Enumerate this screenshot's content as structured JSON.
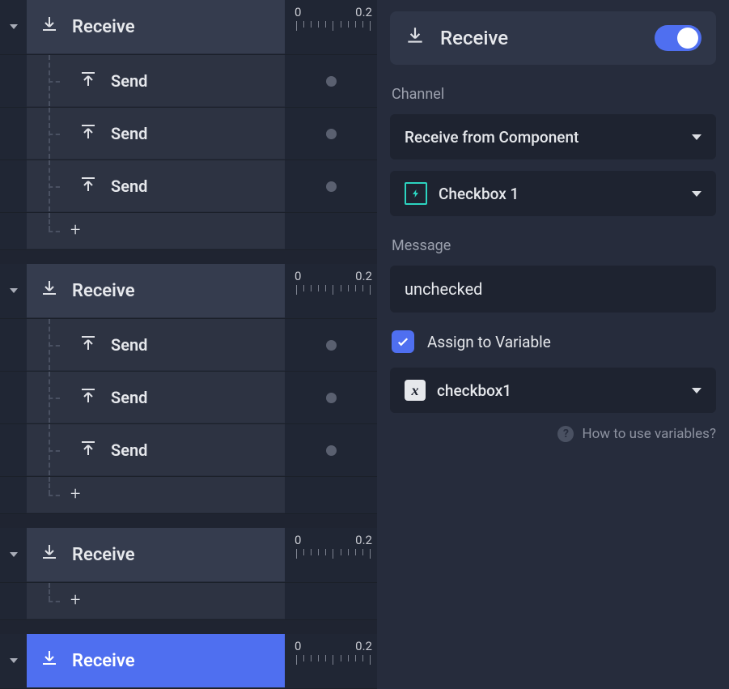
{
  "ruler": {
    "start": "0",
    "end": "0.2"
  },
  "labels": {
    "receive": "Receive",
    "send": "Send"
  },
  "left_groups": [
    {
      "header": "receive",
      "children": [
        "send",
        "send",
        "send"
      ],
      "has_add": true,
      "selected": false
    },
    {
      "header": "receive",
      "children": [
        "send",
        "send",
        "send"
      ],
      "has_add": true,
      "selected": false
    },
    {
      "header": "receive",
      "children": [],
      "has_add": true,
      "selected": false
    },
    {
      "header": "receive",
      "children": [],
      "has_add": false,
      "selected": true
    }
  ],
  "panel": {
    "title": "Receive",
    "toggle_on": true,
    "channel_label": "Channel",
    "channel_mode": "Receive from Component",
    "channel_target": "Checkbox 1",
    "message_label": "Message",
    "message_value": "unchecked",
    "assign_checkbox_label": "Assign to Variable",
    "assign_checked": true,
    "variable_name": "checkbox1",
    "help_text": "How to use variables?"
  }
}
